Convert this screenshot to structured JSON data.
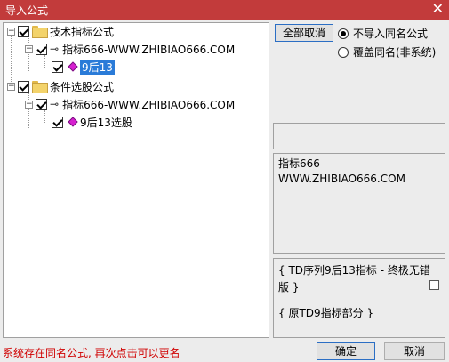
{
  "window": {
    "title": "导入公式",
    "close_glyph": "✕"
  },
  "tree": {
    "groups": [
      {
        "label": "技术指标公式",
        "formula": "指标666-WWW.ZHIBIAO666.COM",
        "item": "9后13"
      },
      {
        "label": "条件选股公式",
        "formula": "指标666-WWW.ZHIBIAO666.COM",
        "item": "9后13选股"
      }
    ]
  },
  "options": {
    "select_all_label": "全部取消",
    "radio_skip": "不导入同名公式",
    "radio_overwrite": "覆盖同名(非系统)"
  },
  "description": {
    "line1": "指标666",
    "line2": "WWW.ZHIBIAO666.COM"
  },
  "note": {
    "line1": "{ TD序列9后13指标 - 终极无错",
    "line2": "版 }",
    "line3": "{ 原TD9指标部分 }"
  },
  "status": {
    "message": "系统存在同名公式, 再次点击可以更名"
  },
  "footer": {
    "ok_label": "确定",
    "cancel_label": "取消"
  }
}
